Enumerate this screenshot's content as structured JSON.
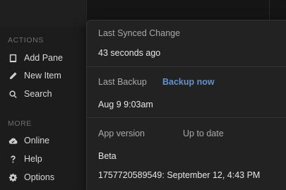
{
  "sidebar": {
    "actions_title": "ACTIONS",
    "actions": [
      {
        "label": "Add Pane",
        "icon": "tablet-icon"
      },
      {
        "label": "New Item",
        "icon": "pencil-icon"
      },
      {
        "label": "Search",
        "icon": "search-icon"
      }
    ],
    "more_title": "MORE",
    "more": [
      {
        "label": "Online",
        "icon": "cloud-check-icon"
      },
      {
        "label": "Help",
        "icon": "question-icon"
      },
      {
        "label": "Options",
        "icon": "gear-icon"
      }
    ]
  },
  "popover": {
    "last_synced_label": "Last Synced Change",
    "last_synced_value": "43 seconds ago",
    "last_backup_label": "Last Backup",
    "backup_now": "Backup now",
    "last_backup_value": "Aug 9 9:03am",
    "app_version_label": "App version",
    "update_status": "Up to date",
    "channel": "Beta",
    "build": "1757720589549: September 12, 4:43 PM"
  },
  "colors": {
    "link": "#5c93d6",
    "background": "#161616",
    "popover": "#222222"
  }
}
